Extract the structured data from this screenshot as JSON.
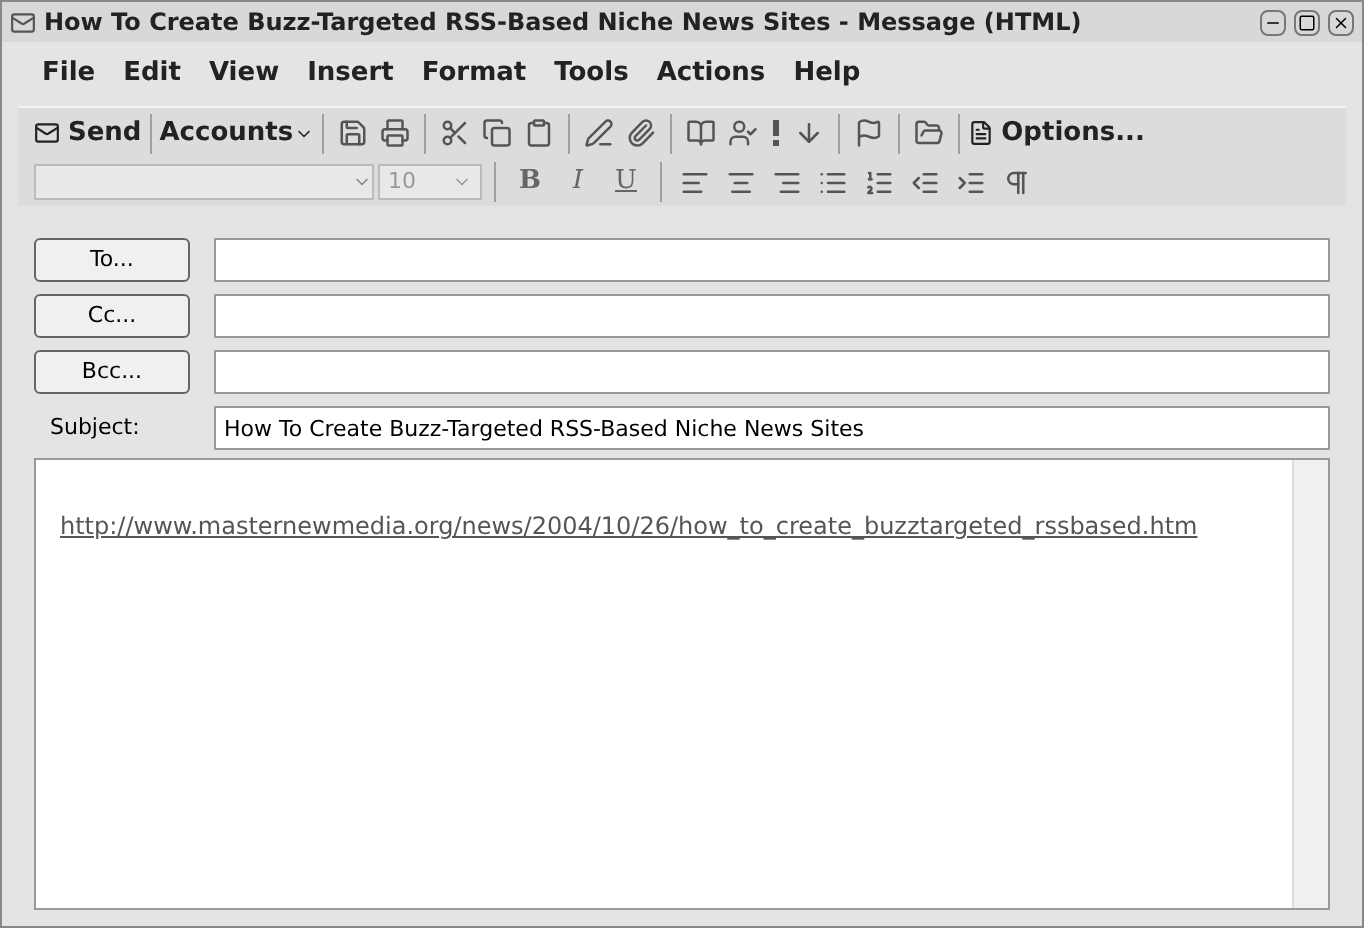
{
  "window": {
    "title": "How To Create Buzz-Targeted RSS-Based Niche News Sites - Message (HTML)"
  },
  "menu": [
    "File",
    "Edit",
    "View",
    "Insert",
    "Format",
    "Tools",
    "Actions",
    "Help"
  ],
  "toolbar": {
    "send": "Send",
    "accounts": "Accounts",
    "options": "Options..."
  },
  "format_toolbar": {
    "font_size": "10",
    "styles": [
      "B",
      "I",
      "U"
    ]
  },
  "address_fields": [
    {
      "button": "To..."
    },
    {
      "button": "Cc..."
    },
    {
      "button": "Bcc..."
    }
  ],
  "subject": {
    "label": "Subject:",
    "value": "How To Create Buzz-Targeted RSS-Based Niche News Sites"
  },
  "body": {
    "link": "http://www.masternewmedia.org/news/2004/10/26/how_to_create_buzztargeted_rssbased.htm"
  }
}
